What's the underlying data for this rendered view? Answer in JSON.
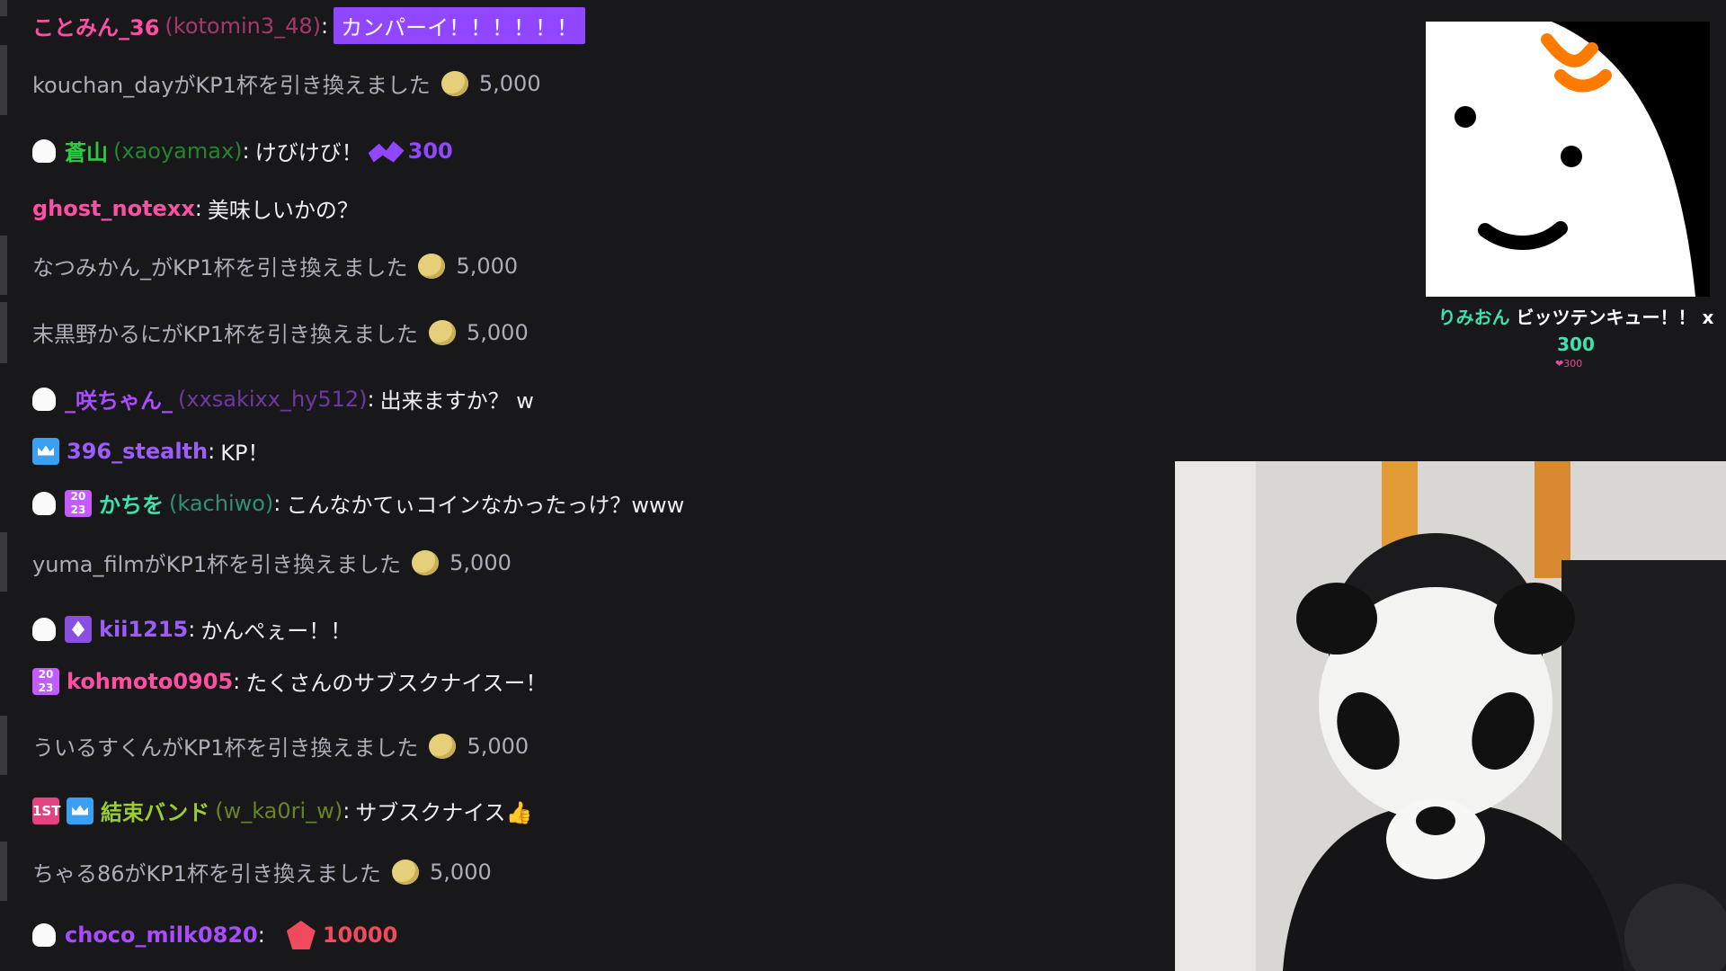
{
  "chat": {
    "messages": [
      {
        "type": "chat",
        "name": "ことみん_36",
        "login": "(kotomin3_48)",
        "text": "カンパーイ！！！！！！",
        "name_color": "#ff4fa3",
        "highlighted": true,
        "badges": []
      },
      {
        "type": "redeem",
        "text": "kouchan_dayがKP1杯を引き換えました",
        "cost": "5,000"
      },
      {
        "type": "chat",
        "name": "蒼山",
        "login": "(xaoyamax)",
        "text": "けびけび！",
        "name_color": "#2ecc40",
        "badges": [
          "ghost"
        ],
        "bits": "300"
      },
      {
        "type": "chat",
        "name": "ghost_notexx",
        "text": "美味しいかの？",
        "name_color": "#ff4fa3",
        "badges": []
      },
      {
        "type": "redeem",
        "text": "なつみかん_がKP1杯を引き換えました",
        "cost": "5,000"
      },
      {
        "type": "redeem",
        "text": "末黒野かるにがKP1杯を引き換えました",
        "cost": "5,000"
      },
      {
        "type": "chat",
        "name": "_咲ちゃん_",
        "login": "(xxsakixx_hy512)",
        "text": "出来ますか？ w",
        "name_color": "#a94cff",
        "badges": [
          "ghost"
        ]
      },
      {
        "type": "chat",
        "name": "396_stealth",
        "text": "KP！",
        "name_color": "#9c5cff",
        "badges": [
          "crown"
        ]
      },
      {
        "type": "chat",
        "name": "かちを",
        "login": "(kachiwo)",
        "text": "こんなかてぃコインなかったっけ？www",
        "name_color": "#3fe0b0",
        "badges": [
          "ghost",
          "year"
        ]
      },
      {
        "type": "redeem",
        "text": "yuma_filmがKP1杯を引き換えました",
        "cost": "5,000"
      },
      {
        "type": "chat",
        "name": "kii1215",
        "text": "かんぺぇー！！",
        "name_color": "#9c5cff",
        "badges": [
          "ghost",
          "diamond"
        ]
      },
      {
        "type": "chat",
        "name": "kohmoto0905",
        "text": "たくさんのサブスクナイスー！",
        "name_color": "#ff4fa3",
        "badges": [
          "year"
        ]
      },
      {
        "type": "redeem",
        "text": "ういるすくんがKP1杯を引き換えました",
        "cost": "5,000"
      },
      {
        "type": "chat",
        "name": "結束バンド",
        "login": "(w_ka0ri_w)",
        "text": "サブスクナイス👍",
        "name_color": "#9acd32",
        "badges": [
          "1st",
          "crown"
        ]
      },
      {
        "type": "redeem",
        "text": "ちゃる86がKP1杯を引き換えました",
        "cost": "5,000"
      },
      {
        "type": "chat",
        "name": "choco_milk0820",
        "text": "",
        "name_color": "#a94cff",
        "badges": [
          "ghost"
        ],
        "cheer": "10000"
      }
    ],
    "year_badge_text": "20\n23",
    "first_badge_text": "1ST"
  },
  "alert": {
    "user": "りみおん",
    "message": "ビッツテンキュー！！ x",
    "amount": "300",
    "small": "❤300"
  }
}
